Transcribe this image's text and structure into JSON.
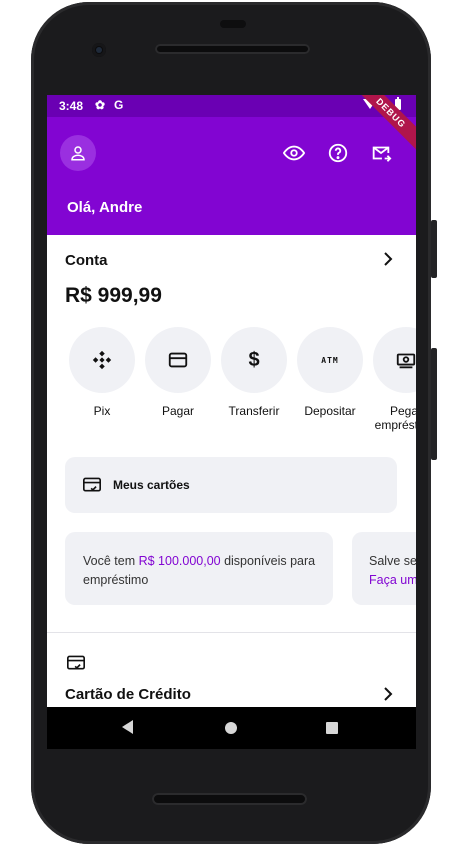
{
  "status_bar": {
    "time": "3:48",
    "gear_glyph": "✿",
    "g_letter": "G",
    "debug_label": "DEBUG"
  },
  "header": {
    "greeting": "Olá, Andre"
  },
  "account": {
    "title": "Conta",
    "balance": "R$ 999,99"
  },
  "actions": [
    {
      "label": "Pix",
      "icon": "pix-icon"
    },
    {
      "label": "Pagar",
      "icon": "card-icon"
    },
    {
      "label": "Transferir",
      "icon": "dollar-icon"
    },
    {
      "label": "Depositar",
      "icon": "atm-icon",
      "glyph": "ATM"
    },
    {
      "label": "Pegar\nempréstimo",
      "icon": "cash-icon"
    }
  ],
  "cards_button": {
    "label": "Meus cartões"
  },
  "info_loan": {
    "prefix": "Você tem ",
    "amount": "R$ 100.000,00",
    "suffix": " disponíveis para empréstimo"
  },
  "info_save": {
    "line1": "Salve seus amigos da burocracia",
    "link": "Faça uma doação"
  },
  "credit_card": {
    "title": "Cartão de Crédito"
  },
  "colors": {
    "brand": "#8205d2",
    "status_bar": "#6a00b3",
    "surface": "#f0f1f5"
  }
}
